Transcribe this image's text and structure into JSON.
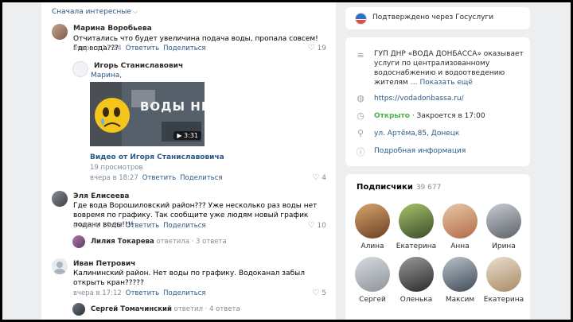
{
  "feed": {
    "sort_label": "Сначала интересные",
    "comments": [
      {
        "name": "Марина Воробьева",
        "text": "Отчитались что будет увеличина подача воды, пропала совсем! Где вода???",
        "time": "вчера в 17:24",
        "reply": "Ответить",
        "share": "Поделиться",
        "likes": "19"
      },
      {
        "name": "Игорь Станиславович",
        "mention": "Марина,",
        "video_title_text": "ВОДЫ НЕТ...",
        "video_duration": "3:31",
        "video_link": "Видео от Игоря Станиславовича",
        "video_views": "19 просмотров",
        "time": "вчера в 18:27",
        "reply": "Ответить",
        "share": "Поделиться",
        "likes": "4"
      },
      {
        "name": "Эля Елисеева",
        "text": "Где вода Ворошиловский район??? Уже несколько раз воды нет вовремя по графику. Так сообщите уже людям новый график подачи воды!!!!",
        "time": "вчера в 17:25",
        "reply": "Ответить",
        "share": "Поделиться",
        "likes": "10",
        "thread_name": "Лилия Токарева",
        "thread_action": "ответила",
        "thread_count": "· 3 ответа"
      },
      {
        "name": "Иван Петрович",
        "text": "Калининский район. Нет воды по графику. Водоканал забыл открыть кран?????",
        "time": "вчера в 17:12",
        "reply": "Ответить",
        "share": "Поделиться",
        "likes": "5",
        "thread_name": "Сергей Томачинский",
        "thread_action": "ответил",
        "thread_count": "· 4 ответа"
      }
    ]
  },
  "sidebar": {
    "gosuslugi_text": "Подтверждено через Госуслуги",
    "info": {
      "description": "ГУП ДНР «ВОДА ДОНБАССА» оказывает услуги по централизованному водоснабжению и водоотведению жителям",
      "show_more": "… Показать ещё",
      "website": "https://vodadonbassa.ru/",
      "status_open": "Открыто",
      "status_close": " · Закроется в 17:00",
      "address": "ул. Артёма,85, Донецк",
      "details": "Подробная информация"
    },
    "subscribers": {
      "title": "Подписчики",
      "count": "39 677",
      "people": [
        "Алина",
        "Екатерина",
        "Анна",
        "Ирина",
        "Сергей",
        "Оленька",
        "Максим",
        "Екатерина"
      ]
    }
  },
  "colors": {
    "link": "#2a5885",
    "muted": "#818c99",
    "open_green": "#4bb34b",
    "background": "#edeef0"
  },
  "icons": {
    "like": "heart-icon",
    "web": "globe-icon",
    "clock": "clock-icon",
    "location": "pin-icon",
    "info": "info-icon"
  }
}
